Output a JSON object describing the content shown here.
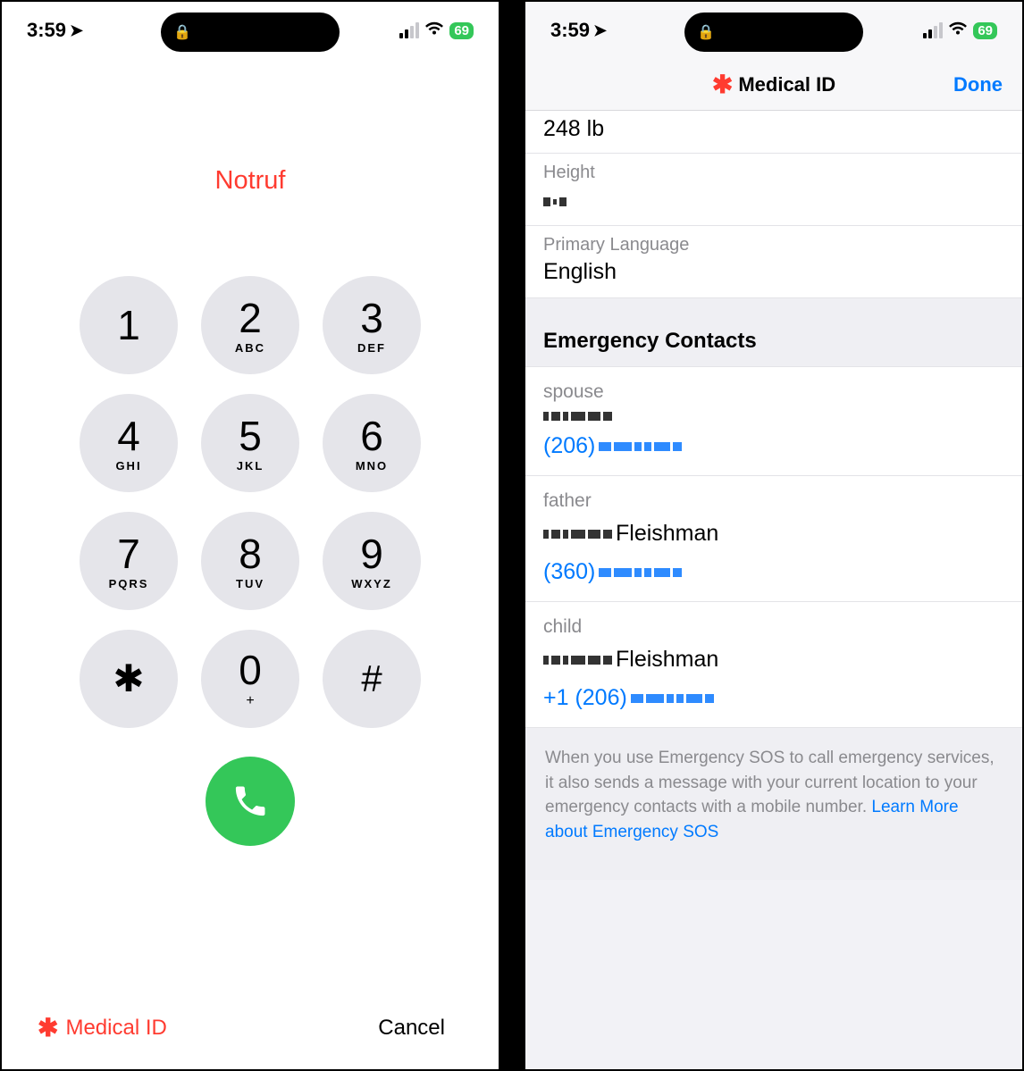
{
  "status": {
    "time": "3:59",
    "battery": "69"
  },
  "dialer": {
    "title": "Notruf",
    "keys": [
      {
        "d": "1",
        "l": ""
      },
      {
        "d": "2",
        "l": "ABC"
      },
      {
        "d": "3",
        "l": "DEF"
      },
      {
        "d": "4",
        "l": "GHI"
      },
      {
        "d": "5",
        "l": "JKL"
      },
      {
        "d": "6",
        "l": "MNO"
      },
      {
        "d": "7",
        "l": "PQRS"
      },
      {
        "d": "8",
        "l": "TUV"
      },
      {
        "d": "9",
        "l": "WXYZ"
      },
      {
        "d": "✱",
        "l": ""
      },
      {
        "d": "0",
        "l": "+"
      },
      {
        "d": "#",
        "l": ""
      }
    ],
    "medical_id_label": "Medical ID",
    "cancel_label": "Cancel"
  },
  "medid": {
    "nav_title": "Medical ID",
    "done_label": "Done",
    "weight_value": "248 lb",
    "height_label": "Height",
    "height_value": "",
    "lang_label": "Primary Language",
    "lang_value": "English",
    "contacts_header": "Emergency Contacts",
    "contacts": [
      {
        "rel": "spouse",
        "name_tail": "",
        "phone_prefix": "(206)"
      },
      {
        "rel": "father",
        "name_tail": "Fleishman",
        "phone_prefix": "(360)"
      },
      {
        "rel": "child",
        "name_tail": "Fleishman",
        "phone_prefix": "+1 (206)"
      }
    ],
    "footer_text": "When you use Emergency SOS to call emergency services, it also sends a message with your current location to your emergency contacts with a mobile number. ",
    "footer_link": "Learn More about Emergency SOS"
  }
}
